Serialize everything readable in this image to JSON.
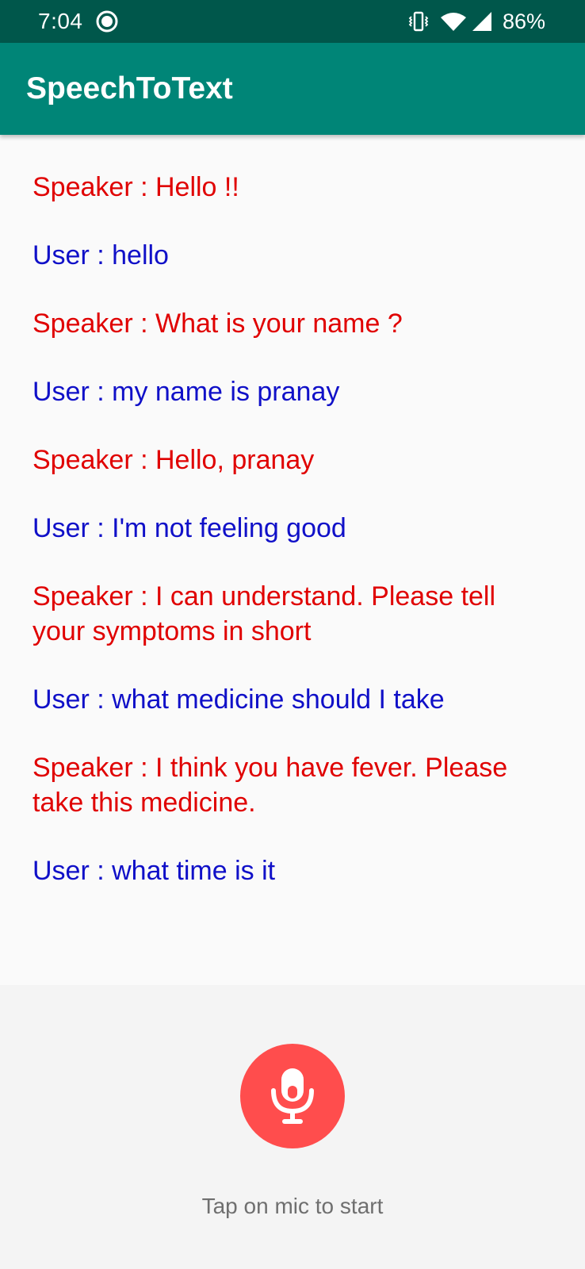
{
  "status_bar": {
    "time": "7:04",
    "battery": "86%",
    "icons": [
      "record-icon",
      "vibrate-icon",
      "wifi-icon",
      "signal-icon"
    ]
  },
  "app_bar": {
    "title": "SpeechToText",
    "color": "#008577"
  },
  "conversation": {
    "messages": [
      {
        "role": "speaker",
        "text": "Speaker : Hello !!"
      },
      {
        "role": "user",
        "text": "User : hello"
      },
      {
        "role": "speaker",
        "text": "Speaker : What is your name ?"
      },
      {
        "role": "user",
        "text": "User : my name is pranay"
      },
      {
        "role": "speaker",
        "text": "Speaker : Hello, pranay"
      },
      {
        "role": "user",
        "text": "User : I'm not feeling good"
      },
      {
        "role": "speaker",
        "text": "Speaker : I can understand. Please tell your symptoms in short"
      },
      {
        "role": "user",
        "text": "User : what medicine should I take"
      },
      {
        "role": "speaker",
        "text": "Speaker : I think you have fever. Please take this medicine."
      },
      {
        "role": "user",
        "text": "User : what time is it"
      }
    ],
    "speaker_color": "#e00000",
    "user_color": "#1010c8"
  },
  "mic": {
    "icon": "microphone-icon",
    "color": "#ff4d4d",
    "hint": "Tap on mic to start"
  }
}
